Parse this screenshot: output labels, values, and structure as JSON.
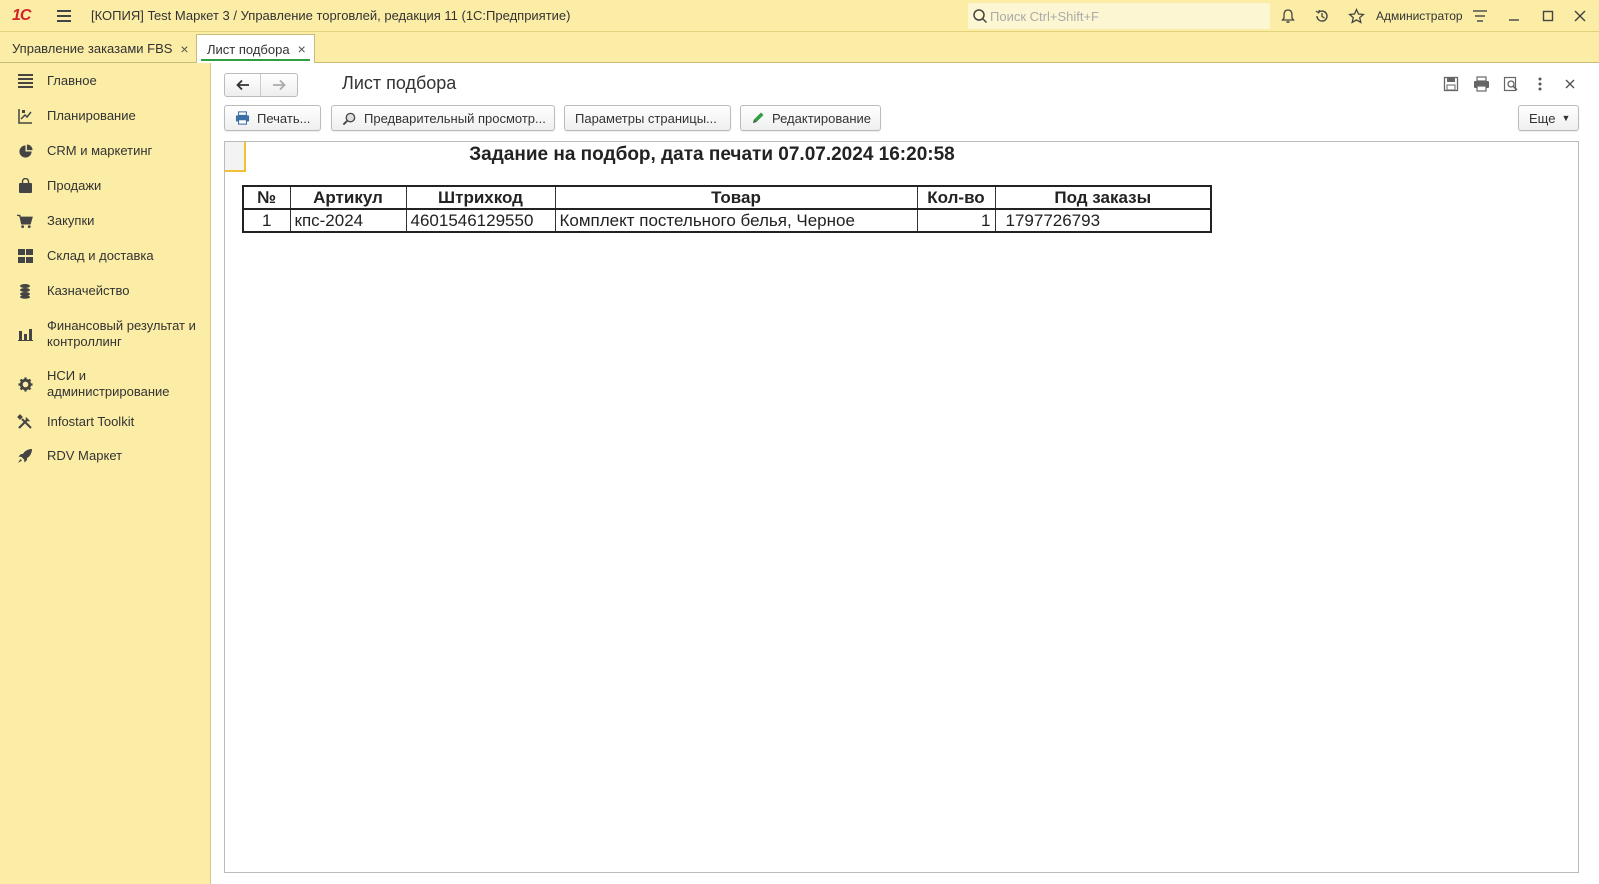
{
  "window": {
    "title": "[КОПИЯ] Test Маркет 3 / Управление торговлей, редакция 11  (1С:Предприятие)",
    "logo": "1С",
    "search_placeholder": "Поиск Ctrl+Shift+F",
    "user": "Администратор"
  },
  "tabs": [
    {
      "label": "Управление заказами FBS",
      "active": false
    },
    {
      "label": "Лист подбора",
      "active": true
    }
  ],
  "sidebar": {
    "items": [
      {
        "label": "Главное",
        "icon": "menu-lines-icon"
      },
      {
        "label": "Планирование",
        "icon": "planning-icon"
      },
      {
        "label": "CRM и маркетинг",
        "icon": "pie-chart-icon"
      },
      {
        "label": "Продажи",
        "icon": "shopping-bag-icon"
      },
      {
        "label": "Закупки",
        "icon": "cart-icon"
      },
      {
        "label": "Склад и доставка",
        "icon": "warehouse-grid-icon"
      },
      {
        "label": "Казначейство",
        "icon": "coins-icon"
      },
      {
        "label": "Финансовый результат и контроллинг",
        "icon": "bar-chart-icon"
      },
      {
        "label": "НСИ и администрирование",
        "icon": "gear-icon"
      },
      {
        "label": "Infostart Toolkit",
        "icon": "tools-icon"
      },
      {
        "label": "RDV Маркет",
        "icon": "rocket-icon"
      }
    ]
  },
  "main": {
    "title": "Лист подбора",
    "buttons": {
      "print": "Печать...",
      "preview": "Предварительный просмотр...",
      "page_params": "Параметры страницы...",
      "edit": "Редактирование",
      "more": "Еще"
    },
    "document": {
      "heading": "Задание на подбор, дата печати 07.07.2024 16:20:58",
      "columns": [
        "№",
        "Артикул",
        "Штрихкод",
        "Товар",
        "Кол-во",
        "Под заказы"
      ],
      "rows": [
        [
          "1",
          "кпс-2024",
          "4601546129550",
          "Комплект постельного белья, Черное",
          "1",
          "1797726793"
        ]
      ]
    }
  },
  "colors": {
    "panel_bg": "#fbeda6",
    "accent_green": "#2f9e44",
    "logo_red": "#d2232a",
    "cell_highlight": "#f2c037"
  }
}
